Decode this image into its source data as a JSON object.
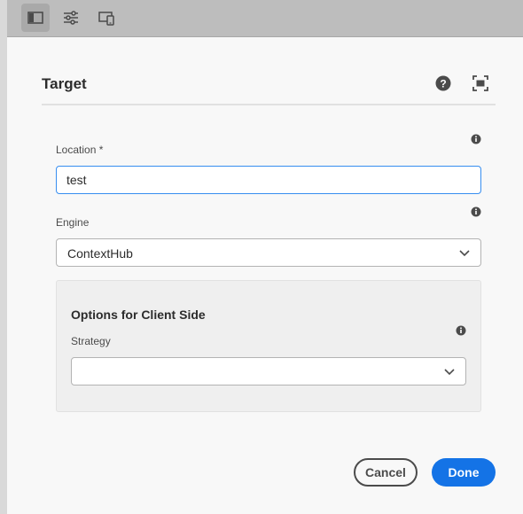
{
  "toolbar": {
    "buttons": [
      {
        "icon": "side-panel-icon",
        "active": true
      },
      {
        "icon": "properties-sliders-icon",
        "active": false
      },
      {
        "icon": "device-preview-icon",
        "active": false
      }
    ]
  },
  "dialog": {
    "title": "Target",
    "help_icon": "help-icon",
    "fullscreen_icon": "fullscreen-icon",
    "location": {
      "label": "Location *",
      "value": "test",
      "info_icon": "info-icon"
    },
    "engine": {
      "label": "Engine",
      "selected": "ContextHub",
      "info_icon": "info-icon"
    },
    "client_options": {
      "title": "Options for Client Side",
      "strategy": {
        "label": "Strategy",
        "selected": "",
        "info_icon": "info-icon"
      }
    },
    "cancel_label": "Cancel",
    "done_label": "Done"
  },
  "colors": {
    "primary": "#1473e6",
    "input_focus": "#378ef0",
    "toolbar_bg": "#bdbdbd",
    "dialog_bg": "#f8f8f8"
  }
}
